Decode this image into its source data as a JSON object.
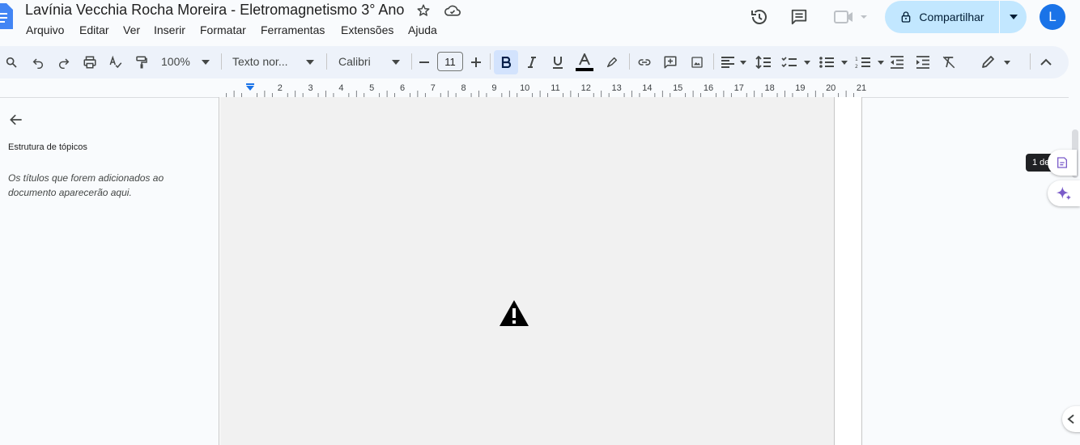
{
  "app": {
    "title": "Lavínia Vecchia Rocha Moreira - Eletromagnetismo 3° Ano",
    "icons": [
      "docs-logo-icon",
      "star-icon",
      "cloud-saved-icon"
    ]
  },
  "menu": [
    "Arquivo",
    "Editar",
    "Ver",
    "Inserir",
    "Formatar",
    "Ferramentas",
    "Extensões",
    "Ajuda"
  ],
  "header_right": {
    "share_label": "Compartilhar",
    "avatar_initial": "L",
    "icons": [
      "history-icon",
      "comment-icon",
      "meet-icon",
      "lock-icon"
    ]
  },
  "toolbar": {
    "zoom": "100%",
    "style": "Texto nor...",
    "font": "Calibri",
    "font_size": "11",
    "bold_active": true,
    "text_color": "#000000"
  },
  "ruler": {
    "labels": [
      "2",
      "3",
      "4",
      "5",
      "6",
      "7",
      "8",
      "9",
      "10",
      "11",
      "12",
      "13",
      "14",
      "15",
      "16",
      "17",
      "18",
      "19",
      "20",
      "21"
    ]
  },
  "outline": {
    "title": "Estrutura de tópicos",
    "empty_message": "Os títulos que forem adicionados ao documento aparecerão aqui."
  },
  "right_rail": {
    "tooltip": "1 de"
  },
  "colors": {
    "accent": "#1a73e8",
    "share_bg": "#c2e7ff",
    "toolbar_bg": "#edf2fa",
    "background": "#f9fbfd"
  }
}
